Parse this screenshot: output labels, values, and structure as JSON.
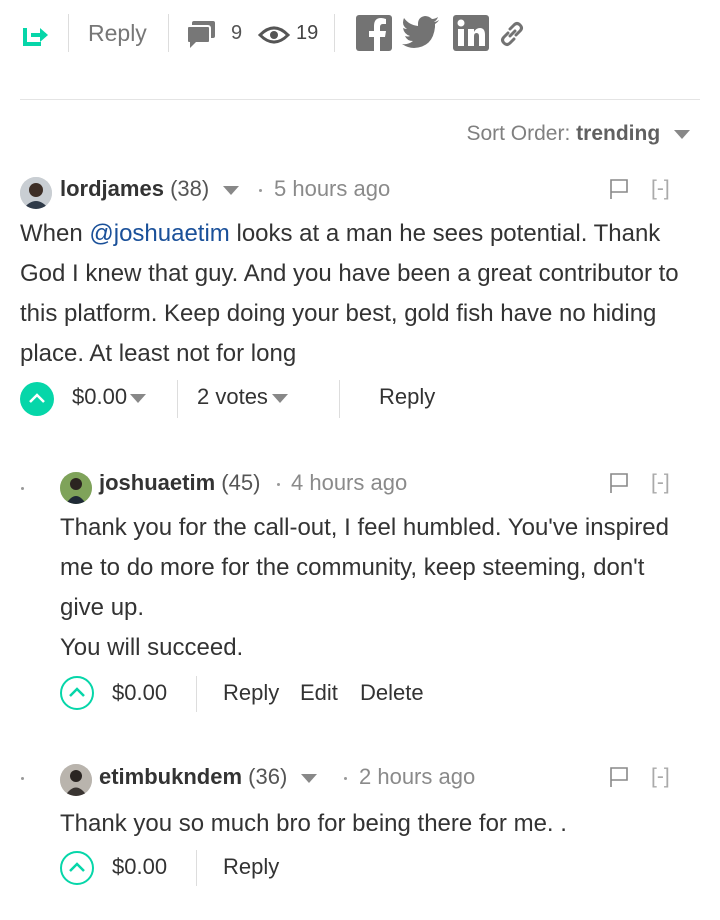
{
  "toolbar": {
    "reply_label": "Reply",
    "comment_count": "9",
    "view_count": "19",
    "social_icons": [
      "facebook-icon",
      "twitter-icon",
      "linkedin-icon",
      "link-icon"
    ],
    "accent_color": "#06d6a9"
  },
  "sort": {
    "label": "Sort Order:",
    "value": "trending"
  },
  "comments": [
    {
      "author": "lordjames",
      "reputation": "(38)",
      "time": "5 hours ago",
      "collapse": "[-]",
      "body_prefix": "When ",
      "mention": "@joshuaetim",
      "body_rest": " looks at a man he sees potential. Thank God I knew that guy. And you have been a great contributor to this platform. Keep doing your best, gold fish have no hiding place. At least not for long",
      "payout": "$0.00",
      "votes": "2 votes",
      "reply_label": "Reply",
      "upvoted": true
    },
    {
      "author": "joshuaetim",
      "reputation": "(45)",
      "time": "4 hours ago",
      "collapse": "[-]",
      "body_line1": "Thank you for the call-out, I feel humbled. You've inspired me to do more for the community, keep steeming, don't give up.",
      "body_line2": "You will succeed.",
      "payout": "$0.00",
      "reply_label": "Reply",
      "edit_label": "Edit",
      "delete_label": "Delete",
      "upvoted": false
    },
    {
      "author": "etimbukndem",
      "reputation": "(36)",
      "time": "2 hours ago",
      "collapse": "[-]",
      "body": "Thank you so much bro for being there for me. .",
      "payout": "$0.00",
      "reply_label": "Reply",
      "upvoted": false
    }
  ]
}
